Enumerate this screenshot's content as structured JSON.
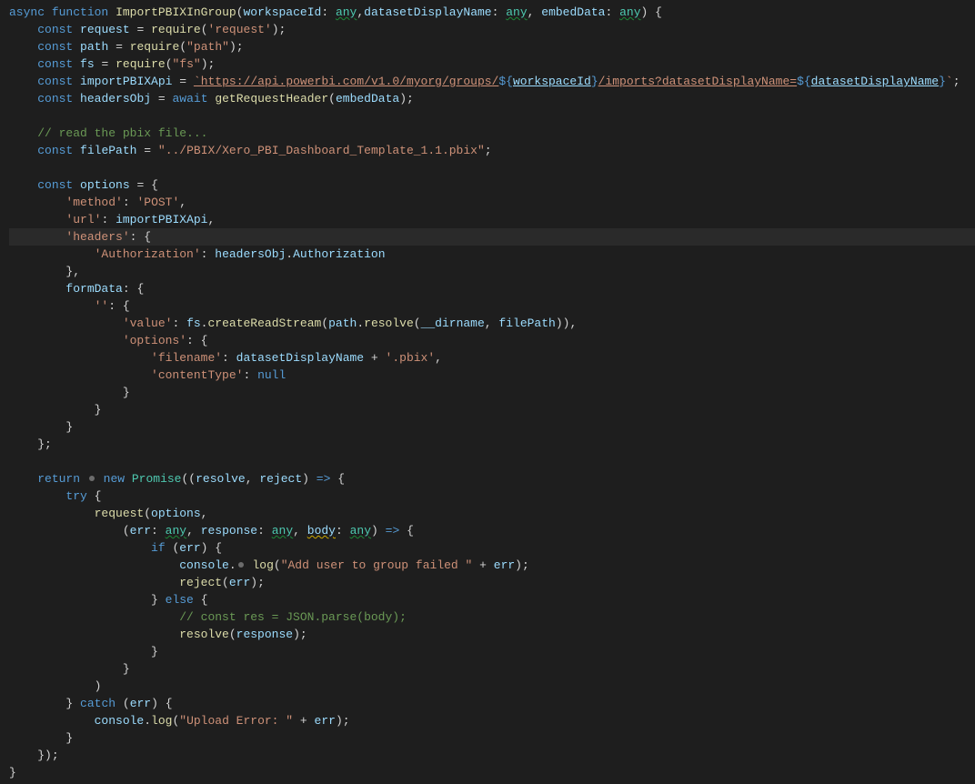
{
  "sig": {
    "async": "async",
    "function": "function",
    "name": "ImportPBIXInGroup",
    "p1": "workspaceId",
    "p2": "datasetDisplayName",
    "p3": "embedData",
    "any": "any"
  },
  "kw": {
    "const": "const",
    "await": "await",
    "return": "return",
    "new": "new",
    "try": "try",
    "catch": "catch",
    "else": "else",
    "if": "if",
    "null": "null"
  },
  "decl": {
    "request": "request",
    "reqMod": "'request'",
    "path": "path",
    "pathMod": "\"path\"",
    "fs": "fs",
    "fsMod": "\"fs\"",
    "importVar": "importPBIXApi",
    "tpl_pre": "`https://api.powerbi.com/v1.0/myorg/groups/",
    "tpl_mid": "/imports?datasetDisplayName=",
    "tpl_suf": "`",
    "tplv1": "workspaceId",
    "tplv2": "datasetDisplayName",
    "headersVar": "headersObj",
    "getReqHeader": "getRequestHeader",
    "embed": "embedData",
    "commentRead": "// read the pbix file...",
    "filePathVar": "filePath",
    "filePathStr": "\"../PBIX/Xero_PBI_Dashboard_Template_1.1.pbix\""
  },
  "opts": {
    "optionsVar": "options",
    "method_k": "'method'",
    "method_v": "'POST'",
    "url_k": "'url'",
    "url_v": "importPBIXApi",
    "headers_k": "'headers'",
    "auth_k": "'Authorization'",
    "auth_obj": "headersObj",
    "auth_prop": "Authorization",
    "formData": "formData",
    "emptyKey": "''",
    "value_k": "'value'",
    "fs": "fs",
    "createRS": "createReadStream",
    "path": "path",
    "resolve": "resolve",
    "dirname": "__dirname",
    "filePath": "filePath",
    "options_k": "'options'",
    "filename_k": "'filename'",
    "dsn": "datasetDisplayName",
    "pbix": "'.pbix'",
    "ct_k": "'contentType'"
  },
  "prom": {
    "Promise": "Promise",
    "resolve": "resolve",
    "reject": "reject",
    "request": "request",
    "options": "options",
    "err": "err",
    "response": "response",
    "body": "body",
    "any": "any",
    "console": "console",
    "log": "log",
    "msg1": "\"Add user to group failed \"",
    "plus": "+",
    "cmt": "// const res = JSON.parse(body);",
    "msg2": "\"Upload Error: \""
  },
  "fncall": {
    "require": "require"
  }
}
